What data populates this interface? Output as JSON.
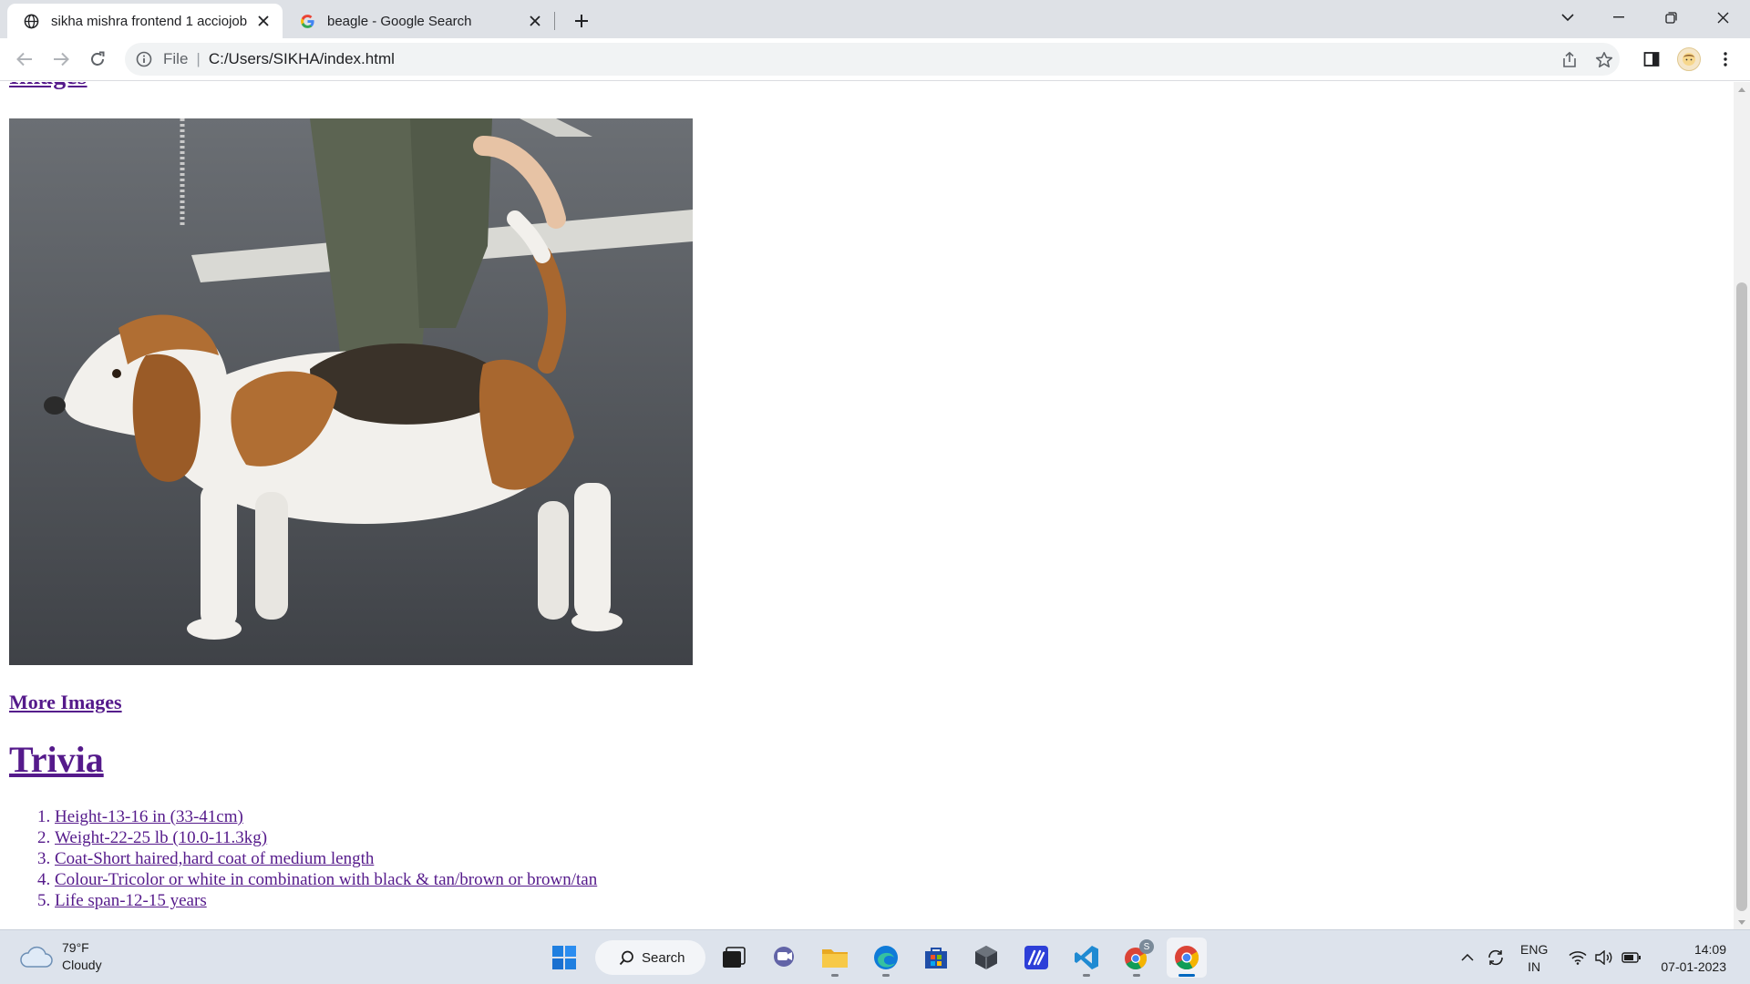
{
  "browser": {
    "tabs": [
      {
        "title": "sikha mishra frontend 1 acciojob",
        "icon": "globe-icon",
        "active": true
      },
      {
        "title": "beagle - Google Search",
        "icon": "google-icon",
        "active": false
      }
    ],
    "address": {
      "scheme_label": "File",
      "url": "C:/Users/SIKHA/index.html"
    }
  },
  "page": {
    "images_heading": "Images",
    "image_alt": "Beagle standing on asphalt",
    "more_images_link": "More Images",
    "trivia_heading": "Trivia",
    "trivia_items": [
      "Height-13-16 in (33-41cm)",
      "Weight-22-25 lb (10.0-11.3kg)",
      "Coat-Short haired,hard coat of medium length",
      "Colour-Tricolor or white in combination with black & tan/brown or brown/tan",
      "Life span-12-15 years"
    ],
    "link_color": "#551a8b"
  },
  "taskbar": {
    "weather": {
      "temp": "79°F",
      "condition": "Cloudy"
    },
    "search_label": "Search",
    "language": {
      "line1": "ENG",
      "line2": "IN"
    },
    "clock": {
      "time": "14:09",
      "date": "07-01-2023"
    },
    "chrome_profile_badge": "S",
    "apps": [
      "start-icon",
      "search",
      "task-view-icon",
      "teams-chat-icon",
      "file-explorer-icon",
      "edge-icon",
      "store-icon",
      "app-cube-icon",
      "app-notes-icon",
      "vscode-icon",
      "chrome-profile-icon",
      "chrome-icon"
    ]
  }
}
